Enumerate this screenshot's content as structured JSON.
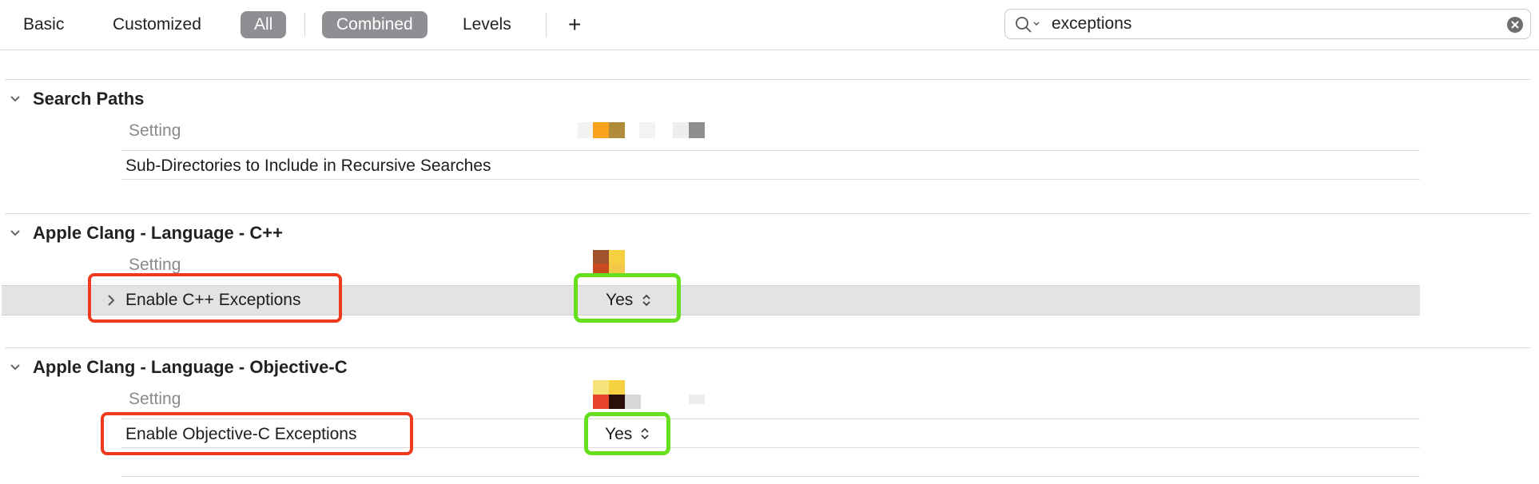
{
  "toolbar": {
    "basic": "Basic",
    "customized": "Customized",
    "all": "All",
    "combined": "Combined",
    "levels": "Levels",
    "add": "+"
  },
  "search": {
    "value": "exceptions",
    "icon": "magnifier-icon",
    "clear_icon": "clear-icon"
  },
  "sections": [
    {
      "title": "Search Paths",
      "header_label": "Setting",
      "rows": [
        {
          "label": "Sub-Directories to Include in Recursive Searches",
          "value": ""
        }
      ]
    },
    {
      "title": "Apple Clang - Language - C++",
      "header_label": "Setting",
      "rows": [
        {
          "label": "Enable C++ Exceptions",
          "value": "Yes",
          "selected": true
        }
      ]
    },
    {
      "title": "Apple Clang - Language - Objective-C",
      "header_label": "Setting",
      "rows": [
        {
          "label": "Enable Objective-C Exceptions",
          "value": "Yes"
        }
      ]
    }
  ],
  "colors": {
    "highlight_red": "#f03a1e",
    "highlight_green": "#66e01e",
    "selected_row": "#e3e3e3",
    "pill": "#8e8e93"
  }
}
